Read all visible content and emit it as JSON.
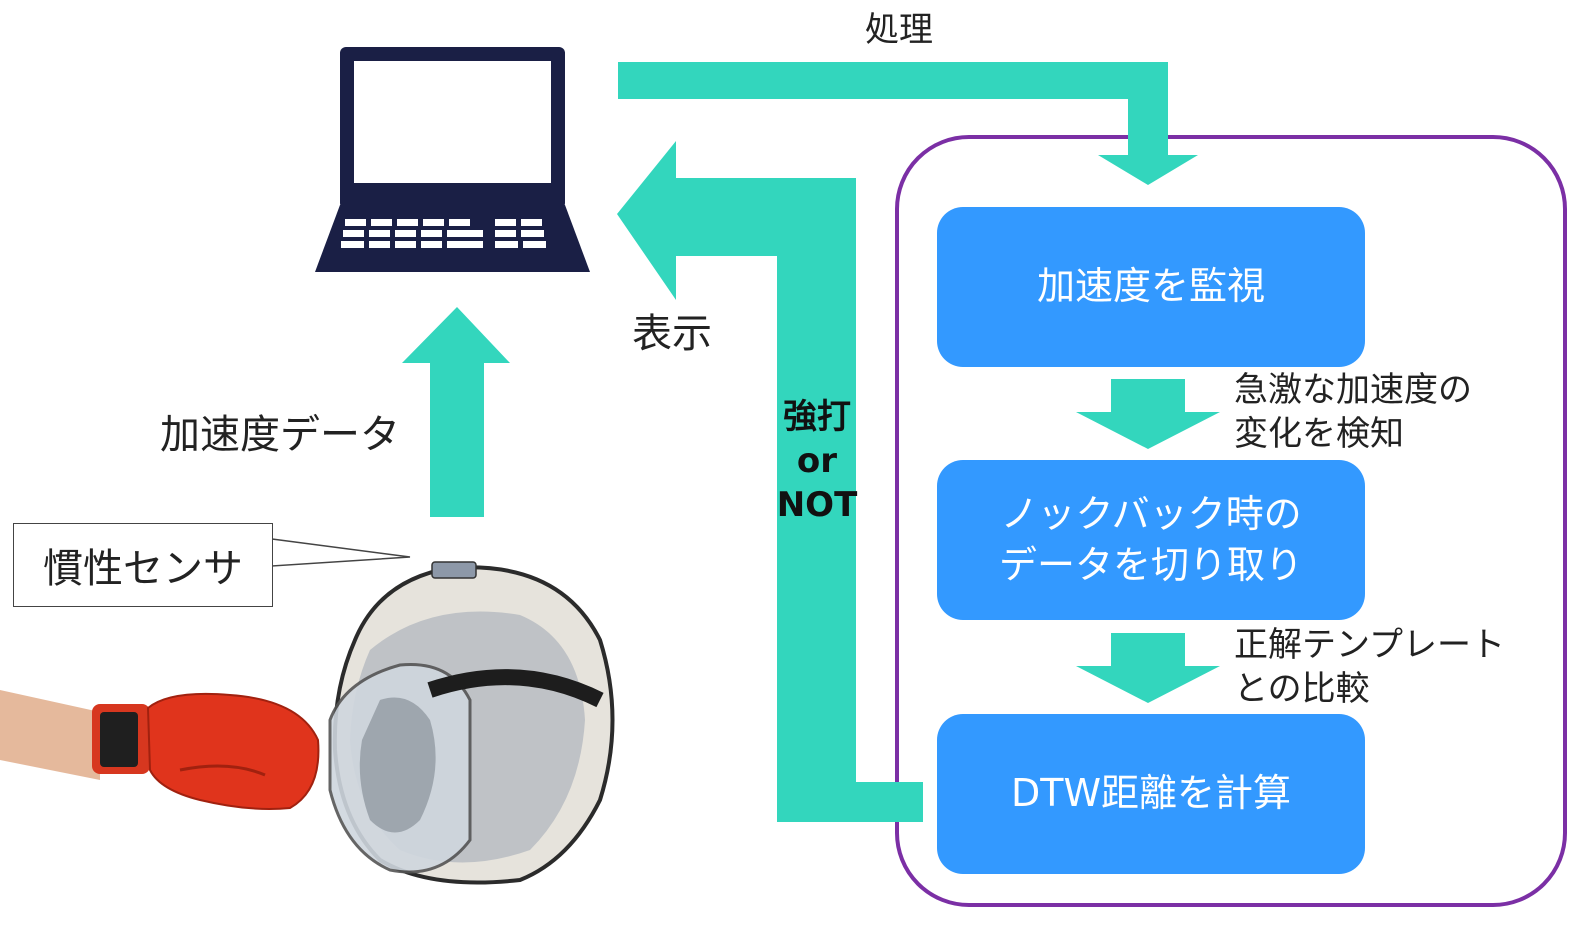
{
  "labels": {
    "process": "処理",
    "display": "表示",
    "accel_data": "加速度データ",
    "strike_or_not": "強打\nor\nNOT",
    "sensor": "慣性センサ",
    "detect_change": "急激な加速度の\n変化を検知",
    "compare_template": "正解テンプレート\nとの比較"
  },
  "flow_steps": [
    "加速度を監視",
    "ノックバック時の\nデータを切り取り",
    "DTW距離を計算"
  ],
  "colors": {
    "arrow": "#33d6bd",
    "box": "#3399ff",
    "frame": "#7b2fa5",
    "laptop": "#1a1f45"
  }
}
